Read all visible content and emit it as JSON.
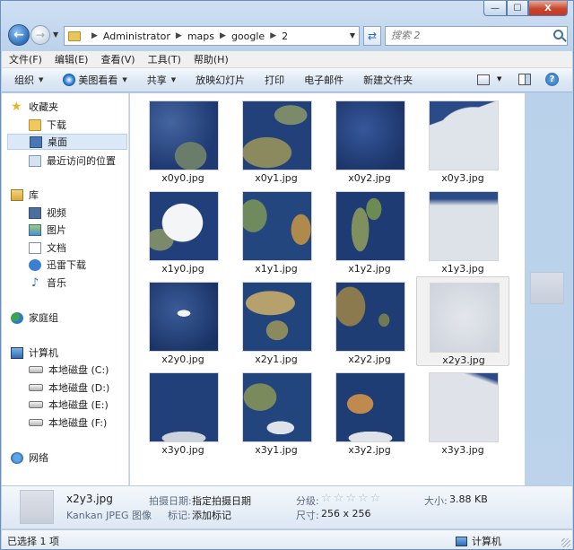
{
  "window": {
    "caption_buttons": {
      "minimize": "—",
      "maximize": "☐",
      "close": "X"
    }
  },
  "address": {
    "breadcrumbs": [
      "Administrator",
      "maps",
      "google",
      "2"
    ],
    "search_placeholder": "搜索 2"
  },
  "menu": [
    "文件(F)",
    "编辑(E)",
    "查看(V)",
    "工具(T)",
    "帮助(H)"
  ],
  "toolbar": {
    "organize": "组织",
    "meitu": "美图看看",
    "share": "共享",
    "slideshow": "放映幻灯片",
    "print": "打印",
    "email": "电子邮件",
    "new_folder": "新建文件夹",
    "help": "?"
  },
  "nav": {
    "favorites": "收藏夹",
    "downloads": "下载",
    "desktop": "桌面",
    "recent": "最近访问的位置",
    "libraries": "库",
    "videos": "视频",
    "pictures": "图片",
    "documents": "文档",
    "xunlei": "迅雷下载",
    "music": "音乐",
    "homegroup": "家庭组",
    "computer": "计算机",
    "disk_c": "本地磁盘 (C:)",
    "disk_d": "本地磁盘 (D:)",
    "disk_e": "本地磁盘 (E:)",
    "disk_f": "本地磁盘 (F:)",
    "network": "网络"
  },
  "files": [
    {
      "name": "x0y0.jpg"
    },
    {
      "name": "x0y1.jpg"
    },
    {
      "name": "x0y2.jpg"
    },
    {
      "name": "x0y3.jpg"
    },
    {
      "name": "x1y0.jpg"
    },
    {
      "name": "x1y1.jpg"
    },
    {
      "name": "x1y2.jpg"
    },
    {
      "name": "x1y3.jpg"
    },
    {
      "name": "x2y0.jpg"
    },
    {
      "name": "x2y1.jpg"
    },
    {
      "name": "x2y2.jpg"
    },
    {
      "name": "x2y3.jpg"
    },
    {
      "name": "x3y0.jpg"
    },
    {
      "name": "x3y1.jpg"
    },
    {
      "name": "x3y2.jpg"
    },
    {
      "name": "x3y3.jpg"
    }
  ],
  "selected_index": 11,
  "details": {
    "filename": "x2y3.jpg",
    "filetype": "Kankan JPEG 图像",
    "date_taken_label": "拍摄日期:",
    "date_taken_value": "指定拍摄日期",
    "tags_label": "标记:",
    "tags_value": "添加标记",
    "rating_label": "分级:",
    "dimensions_label": "尺寸:",
    "dimensions_value": "256 x 256",
    "size_label": "大小:",
    "size_value": "3.88 KB",
    "rating_stars": 0
  },
  "status": {
    "selection": "已选择 1 项",
    "location": "计算机"
  }
}
